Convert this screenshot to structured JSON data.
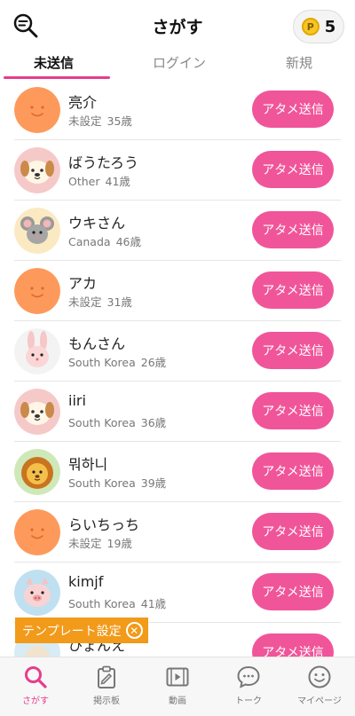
{
  "header": {
    "title": "さがす",
    "coin_symbol": "P",
    "coin_count": "5"
  },
  "tabs": [
    {
      "label": "未送信"
    },
    {
      "label": "ログイン"
    },
    {
      "label": "新規"
    }
  ],
  "users": [
    {
      "name": "亮介",
      "country": "未設定",
      "age": "35歳",
      "button": "アタメ送信",
      "avatar": "default-orange-icon"
    },
    {
      "name": "ばうたろう",
      "country": "Other",
      "age": "41歳",
      "button": "アタメ送信",
      "avatar": "dog-icon"
    },
    {
      "name": "ウキさん",
      "country": "Canada",
      "age": "46歳",
      "button": "アタメ送信",
      "avatar": "mouse-icon"
    },
    {
      "name": "アカ",
      "country": "未設定",
      "age": "31歳",
      "button": "アタメ送信",
      "avatar": "default-orange-icon"
    },
    {
      "name": "もんさん",
      "country": "South Korea",
      "age": "26歳",
      "button": "アタメ送信",
      "avatar": "rabbit-icon"
    },
    {
      "name": "iiri",
      "country": "South Korea",
      "age": "36歳",
      "button": "アタメ送信",
      "avatar": "dog-icon"
    },
    {
      "name": "뭐하니",
      "country": "South Korea",
      "age": "39歳",
      "button": "アタメ送信",
      "avatar": "lion-icon"
    },
    {
      "name": "らいちっち",
      "country": "未設定",
      "age": "19歳",
      "button": "アタメ送信",
      "avatar": "default-orange-icon"
    },
    {
      "name": "kimjf",
      "country": "South Korea",
      "age": "41歳",
      "button": "アタメ送信",
      "avatar": "pig-icon"
    },
    {
      "name": "ひょんえ",
      "country": "",
      "age": "",
      "button": "アタメ送信",
      "avatar": "bear-icon"
    }
  ],
  "template_banner": {
    "label": "テンプレート設定",
    "close_symbol": "✕"
  },
  "bottom_nav": [
    {
      "label": "さがす",
      "icon": "search-icon"
    },
    {
      "label": "掲示板",
      "icon": "clipboard-icon"
    },
    {
      "label": "動画",
      "icon": "video-icon"
    },
    {
      "label": "トーク",
      "icon": "chat-icon"
    },
    {
      "label": "マイページ",
      "icon": "smiley-icon"
    }
  ],
  "colors": {
    "accent_pink": "#f0559a",
    "tab_underline": "#e63d8c",
    "banner_orange": "#f29a1a",
    "default_avatar": "#fd9a5b"
  }
}
